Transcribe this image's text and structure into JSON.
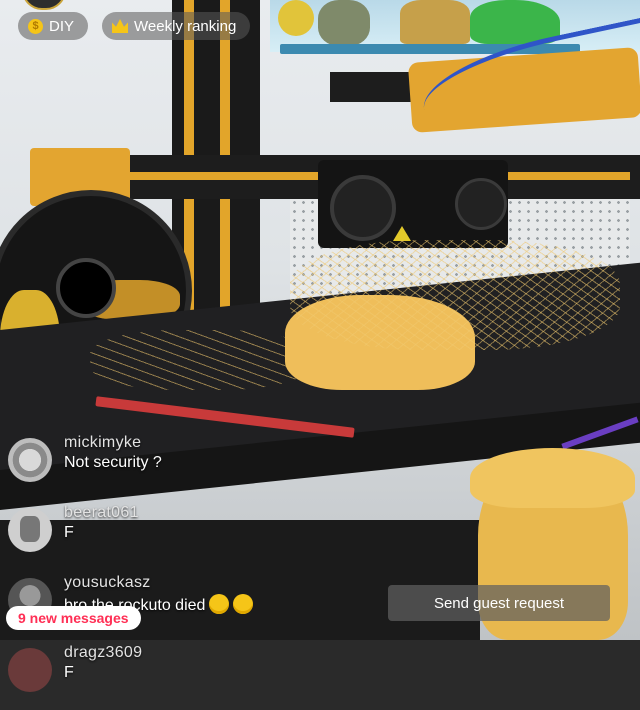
{
  "top_bar": {
    "diy_label": "DIY",
    "ranking_label": "Weekly ranking"
  },
  "chat": {
    "messages": [
      {
        "username": "mickimyke",
        "text": "Not security ?"
      },
      {
        "username": "beerat061",
        "text": "F"
      },
      {
        "username": "yousuckasz",
        "text": "bro the rockuto died"
      },
      {
        "username": "dragz3609",
        "text": "F"
      }
    ]
  },
  "new_messages_label": "9 new messages",
  "guest_request_label": "Send guest request",
  "colors": {
    "accent_gold": "#e2a52a",
    "new_messages_text": "#ff2f55"
  }
}
